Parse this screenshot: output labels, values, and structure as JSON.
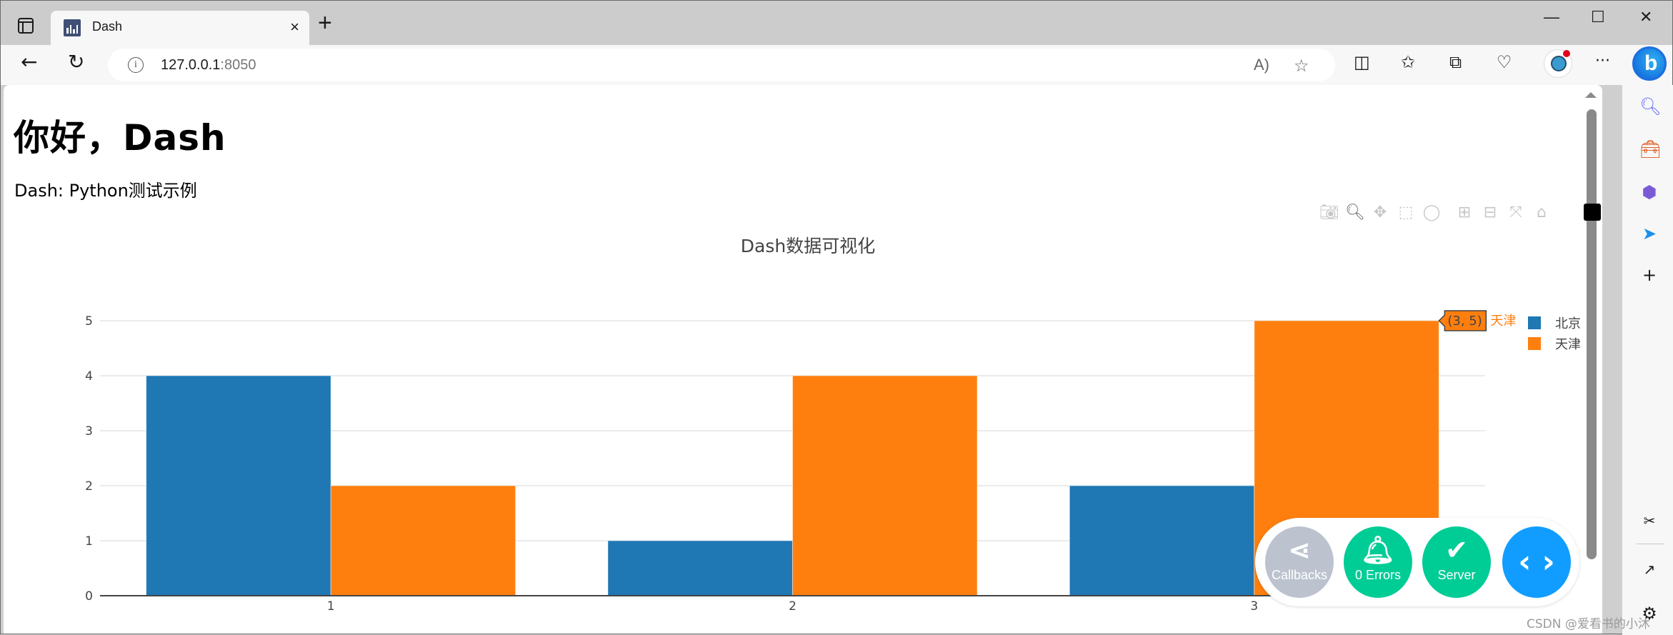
{
  "browser": {
    "tab_title": "Dash",
    "new_tab_glyph": "+",
    "tab_close_glyph": "×",
    "url_host": "127.0.0.1",
    "url_port": ":8050",
    "window_controls": {
      "minimize": "—",
      "maximize": "☐",
      "close": "✕"
    },
    "nav": {
      "back": "←",
      "refresh": "↻"
    },
    "toolbar_icons": [
      "read-aloud-icon",
      "favorite-star-icon",
      "split-screen-icon",
      "favorites-list-icon",
      "collections-icon",
      "browser-essentials-icon",
      "profile-avatar",
      "more-icon",
      "bing-copilot-icon"
    ],
    "more_glyph": "···",
    "bing_glyph": "b",
    "sidebar_icons": [
      "search-icon",
      "tools-icon",
      "office-icon",
      "send-icon",
      "add-icon",
      "screenshot-icon",
      "open-external-icon",
      "settings-icon"
    ]
  },
  "page": {
    "title": "你好，Dash",
    "subtitle": "Dash: Python测试示例"
  },
  "modebar": {
    "buttons": [
      "camera-icon",
      "zoom-icon",
      "pan-icon",
      "box-select-icon",
      "lasso-select-icon",
      "zoom-in-icon",
      "zoom-out-icon",
      "autoscale-icon",
      "reset-axes-icon"
    ],
    "active": "zoom-icon"
  },
  "chart_data": {
    "type": "bar",
    "title": "Dash数据可视化",
    "categories": [
      1,
      2,
      3
    ],
    "x_tick_labels": [
      "1",
      "2",
      "3"
    ],
    "y_tick_labels": [
      "0",
      "1",
      "2",
      "3",
      "4",
      "5"
    ],
    "ylim": [
      0,
      5.0
    ],
    "xlabel": "",
    "ylabel": "",
    "grid": true,
    "legend_position": "top-right",
    "series": [
      {
        "name": "北京",
        "values": [
          4,
          1,
          2
        ],
        "color": "#1f77b4"
      },
      {
        "name": "天津",
        "values": [
          2,
          4,
          5
        ],
        "color": "#ff7f0e"
      }
    ],
    "hover": {
      "text": "(3, 5)",
      "series": "天津",
      "category": 3,
      "value": 5
    }
  },
  "devtools": {
    "buttons": [
      {
        "name": "callbacks-button",
        "icon": "share-icon",
        "label": "Callbacks",
        "color": "#bcc3cf"
      },
      {
        "name": "errors-button",
        "icon": "bell-icon",
        "label": "0 Errors",
        "color": "#00cc96"
      },
      {
        "name": "server-button",
        "icon": "check-icon",
        "label": "Server",
        "color": "#00cc96"
      },
      {
        "name": "toggle-devtools-button",
        "icon": "code-icon",
        "label": "",
        "color": "#119dff"
      }
    ]
  },
  "watermark": "CSDN @爱看书的小沐"
}
